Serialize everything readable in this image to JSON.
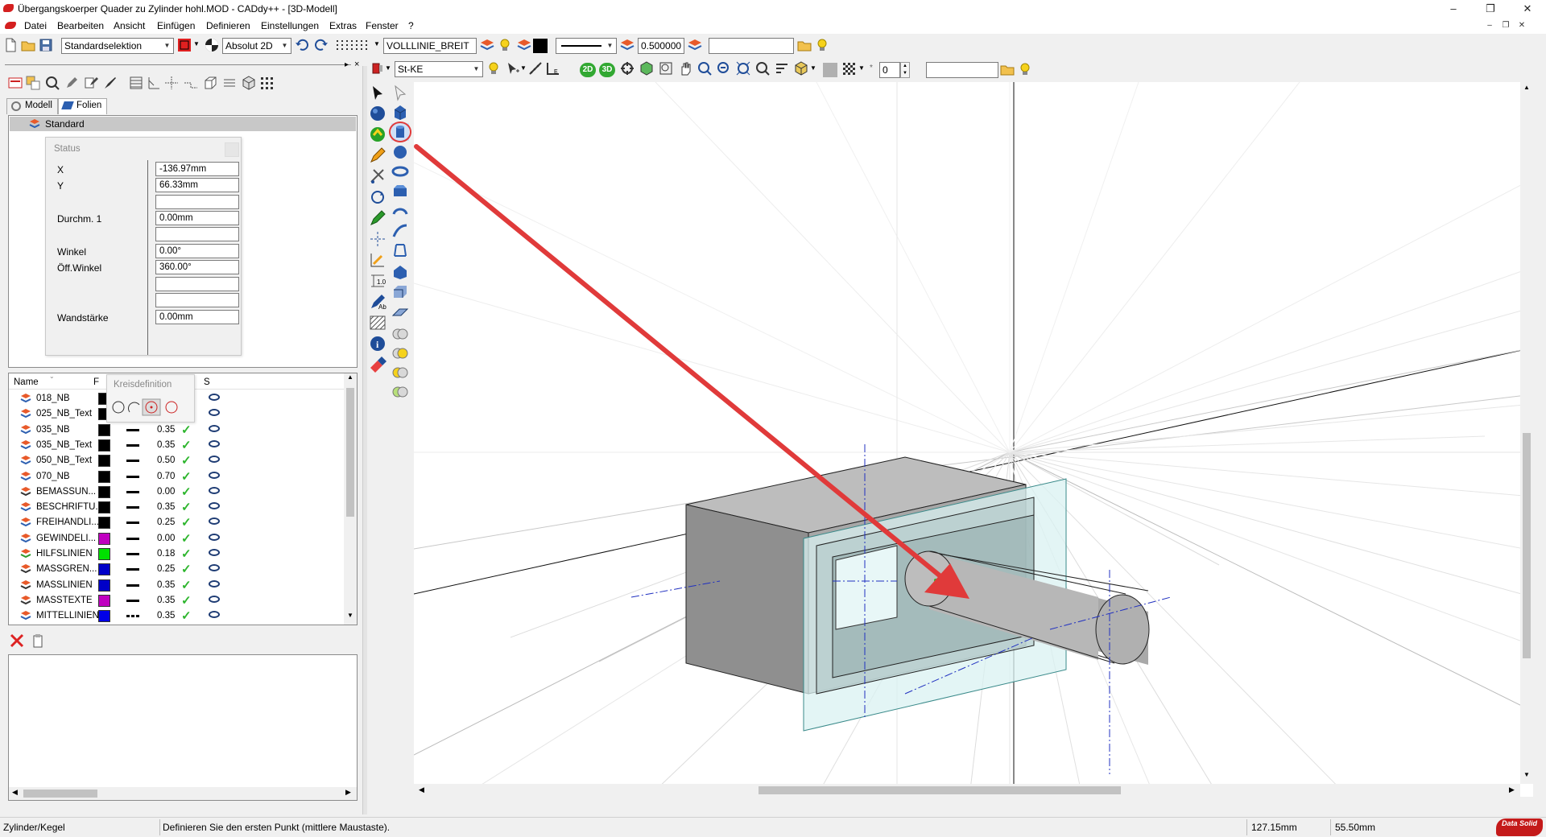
{
  "window": {
    "title": "Übergangskoerper Quader zu Zylinder hohl.MOD  -  CADdy++ - [3D-Modell]",
    "minimize": "–",
    "maximize": "❐",
    "close": "✕"
  },
  "menu": {
    "items": [
      "Datei",
      "Bearbeiten",
      "Ansicht",
      "Einfügen",
      "Definieren",
      "Einstellungen",
      "Extras",
      "Fenster",
      "?"
    ],
    "mdi_minimize": "–",
    "mdi_restore": "❐",
    "mdi_close": "✕"
  },
  "toolbar1": {
    "selection_mode": "Standardselektion",
    "coord_mode": "Absolut 2D",
    "line_type": "VOLLLINIE_BREIT",
    "line_width": "0.500000",
    "text_field": ""
  },
  "toolbar2": {
    "material": "St-KE",
    "btn_2d": "2D",
    "btn_3d": "3D",
    "spin_value": "0",
    "text_field": ""
  },
  "left_panel": {
    "tabs": [
      "Modell",
      "Folien"
    ],
    "tree_root": "Standard",
    "status": {
      "title": "Status",
      "fields": [
        {
          "label": "X",
          "value": "-136.97mm"
        },
        {
          "label": "Y",
          "value": "66.33mm"
        },
        {
          "label": "",
          "value": ""
        },
        {
          "label": "Durchm. 1",
          "value": "0.00mm"
        },
        {
          "label": "",
          "value": ""
        },
        {
          "label": "Winkel",
          "value": "0.00°"
        },
        {
          "label": "Öff.Winkel",
          "value": "360.00°"
        },
        {
          "label": "",
          "value": ""
        },
        {
          "label": "",
          "value": ""
        },
        {
          "label": "Wandstärke",
          "value": "0.00mm"
        }
      ]
    },
    "layer_list": {
      "columns": [
        "Name",
        "F",
        "S"
      ],
      "popup_title": "Kreisdefinition",
      "rows": [
        {
          "name": "018_NB",
          "color": "#000000",
          "width": "",
          "icon": "layer"
        },
        {
          "name": "025_NB_Text",
          "color": "#000000",
          "width": "",
          "icon": "layer"
        },
        {
          "name": "035_NB",
          "color": "#000000",
          "width": "0.35",
          "icon": "layer"
        },
        {
          "name": "035_NB_Text",
          "color": "#000000",
          "width": "0.35",
          "icon": "layer"
        },
        {
          "name": "050_NB_Text",
          "color": "#000000",
          "width": "0.50",
          "icon": "layer"
        },
        {
          "name": "070_NB",
          "color": "#000000",
          "width": "0.70",
          "icon": "layer"
        },
        {
          "name": "BEMASSUN...",
          "color": "#000000",
          "width": "0.00",
          "icon": "dim"
        },
        {
          "name": "BESCHRIFTU...",
          "color": "#000000",
          "width": "0.35",
          "icon": "text"
        },
        {
          "name": "FREIHANDLI...",
          "color": "#000000",
          "width": "0.25",
          "icon": "layer"
        },
        {
          "name": "GEWINDELI...",
          "color": "#c000c0",
          "width": "0.00",
          "icon": "thread"
        },
        {
          "name": "HILFSLINIEN",
          "color": "#00e000",
          "width": "0.18",
          "icon": "aux"
        },
        {
          "name": "MASSGREN...",
          "color": "#0000c8",
          "width": "0.25",
          "icon": "dim"
        },
        {
          "name": "MASSLINIEN",
          "color": "#0000c8",
          "width": "0.35",
          "icon": "dim"
        },
        {
          "name": "MASSTEXTE",
          "color": "#c000c0",
          "width": "0.35",
          "icon": "dim"
        },
        {
          "name": "MITTELLINIEN",
          "color": "#0000e8",
          "width": "0.35",
          "icon": "center"
        }
      ]
    }
  },
  "statusbar": {
    "command": "Zylinder/Kegel",
    "prompt": "Definieren Sie den ersten Punkt (mittlere Maustaste).",
    "coord_x": "127.15mm",
    "coord_y": "55.50mm",
    "logo_text": "Data Solid"
  },
  "colors": {
    "accent_red": "#e03a3a",
    "solid_grey": "#a9a9a9",
    "plate_cyan": "#d9f2f2"
  }
}
